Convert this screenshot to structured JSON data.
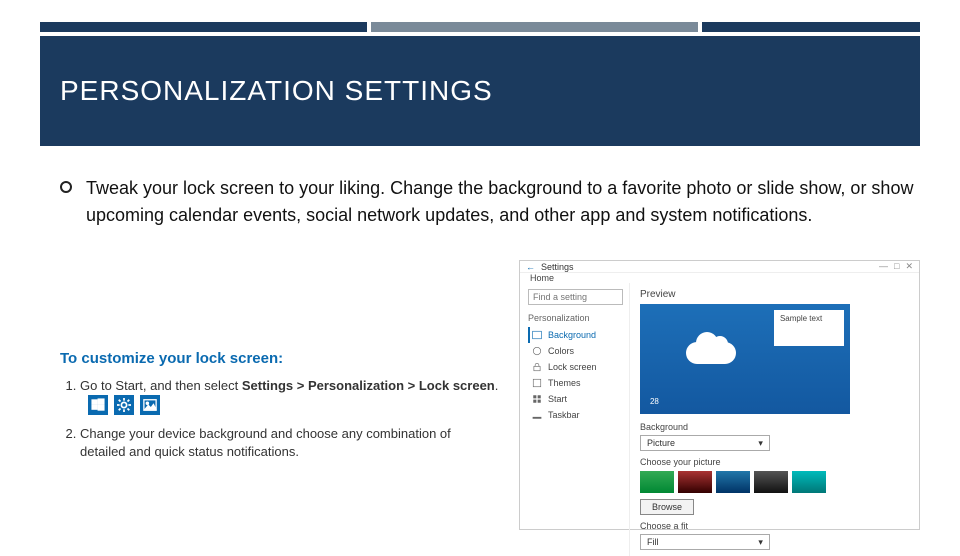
{
  "slide": {
    "title": "PERSONALIZATION SETTINGS",
    "bullet": "Tweak your lock screen to your liking. Change the background to a favorite photo or slide show, or show upcoming calendar events, social network updates, and other app and system notifications."
  },
  "instructions": {
    "heading": "To customize your lock screen:",
    "step1_prefix": "Go to Start, and then select ",
    "step1_bold": "Settings > Personalization > Lock screen",
    "step1_suffix": ".",
    "step2": "Change your device background and choose any combination of detailed and quick status notifications."
  },
  "settings": {
    "window_title": "Settings",
    "home": "Home",
    "search_placeholder": "Find a setting",
    "section": "Personalization",
    "nav": {
      "background": "Background",
      "colors": "Colors",
      "lock_screen": "Lock screen",
      "themes": "Themes",
      "start": "Start",
      "taskbar": "Taskbar"
    },
    "preview_label": "Preview",
    "preview_sample": "Sample text",
    "preview_time": "28",
    "background_label": "Background",
    "background_value": "Picture",
    "choose_picture_label": "Choose your picture",
    "browse_label": "Browse",
    "fit_label": "Choose a fit",
    "fit_value": "Fill"
  }
}
